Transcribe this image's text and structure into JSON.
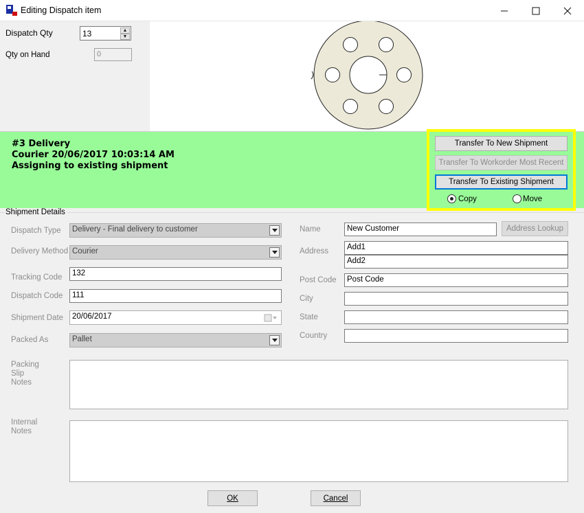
{
  "window": {
    "title": "Editing Dispatch item",
    "minimize_icon": "minimize-icon",
    "maximize_icon": "maximize-icon",
    "close_icon": "close-icon"
  },
  "dispatch": {
    "qty_label": "Dispatch Qty",
    "qty_value": "13",
    "on_hand_label": "Qty on Hand",
    "on_hand_value": "0"
  },
  "status": {
    "line1": "#3 Delivery",
    "line2": "Courier 20/06/2017 10:03:14 AM",
    "line3": "Assigning to existing shipment"
  },
  "transfer": {
    "new_shipment": "Transfer To New Shipment",
    "workorder_recent": "Transfer To Workorder Most Recent",
    "existing_shipment": "Transfer To Existing Shipment",
    "copy_label": "Copy",
    "move_label": "Move",
    "selected": "Copy"
  },
  "shipment": {
    "group_title": "Shipment Details",
    "dispatch_type_label": "Dispatch Type",
    "dispatch_type_value": "Delivery - Final delivery to customer",
    "delivery_method_label": "Delivery Method",
    "delivery_method_value": "Courier",
    "tracking_code_label": "Tracking Code",
    "tracking_code_value": "132",
    "dispatch_code_label": "Dispatch Code",
    "dispatch_code_value": "111",
    "shipment_date_label": "Shipment Date",
    "shipment_date_value": "20/06/2017",
    "packed_as_label": "Packed As",
    "packed_as_value": "Pallet",
    "name_label": "Name",
    "name_value": "New Customer",
    "address_lookup": "Address Lookup",
    "address_label": "Address",
    "address1_value": "Add1",
    "address2_value": "Add2",
    "postcode_label": "Post Code",
    "postcode_value": "Post Code",
    "city_label": "City",
    "city_value": "",
    "state_label": "State",
    "state_value": "",
    "country_label": "Country",
    "country_value": "",
    "packing_notes_label_1": "Packing",
    "packing_notes_label_2": "Slip",
    "packing_notes_label_3": "Notes",
    "internal_notes_label_1": "Internal",
    "internal_notes_label_2": "Notes"
  },
  "footer": {
    "ok_label": "OK",
    "cancel_label": "Cancel"
  },
  "colors": {
    "status_band": "#98fb98",
    "highlight": "#ffff00",
    "focus": "#0078d7"
  }
}
